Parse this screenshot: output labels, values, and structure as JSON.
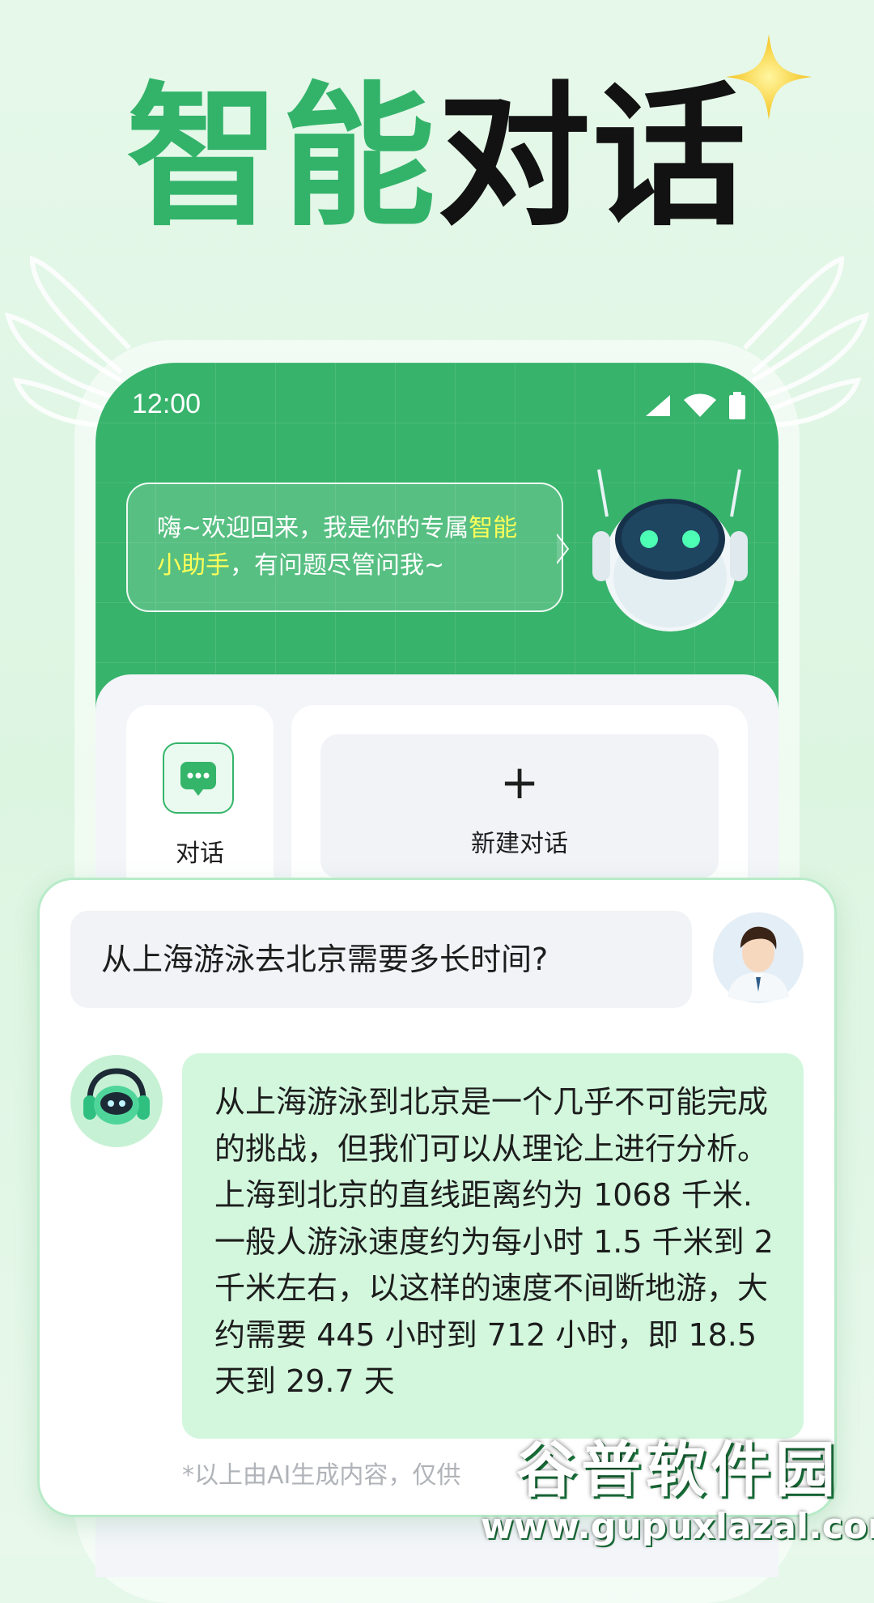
{
  "headline": {
    "green": "智能",
    "black": "对话"
  },
  "status_bar": {
    "time": "12:00",
    "icons": [
      "signal-icon",
      "wifi-icon",
      "battery-icon"
    ]
  },
  "greeting": {
    "part1": "嗨~欢迎回来，我是你的专属",
    "highlight": "智能小助手",
    "part2": "，有问题尽管问我~"
  },
  "nav": {
    "chat_label": "对话",
    "new_chat_label": "新建对话",
    "plus": "+"
  },
  "chat": {
    "user_question": "从上海游泳去北京需要多长时间?",
    "bot_answer": "从上海游泳到北京是一个几乎不可能完成的挑战，但我们可以从理论上进行分析。上海到北京的直线距离约为 1068 千米. 一般人游泳速度约为每小时 1.5 千米到 2 千米左右，以这样的速度不间断地游，大约需要 445 小时到 712 小时，即 18.5 天到 29.7 天",
    "disclaimer": "*以上由AI生成内容，仅供"
  },
  "watermark": {
    "name": "谷普软件园",
    "url": "www.gupuxlazal.com"
  },
  "colors": {
    "brand_green": "#33b36a",
    "screen_green": "#37b36b",
    "bubble_green": "#d2f7dd",
    "highlight_yellow": "#ffff58"
  }
}
